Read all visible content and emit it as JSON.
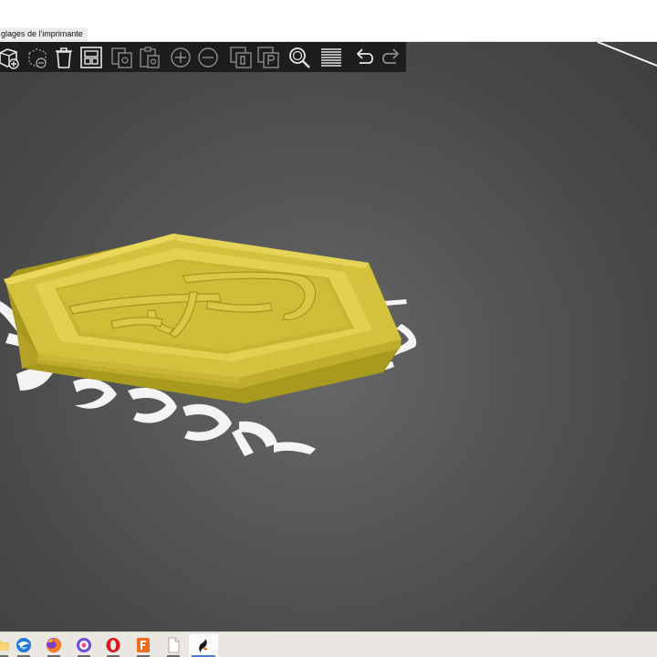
{
  "window": {
    "menu_tab_label": "glages de l'imprimante"
  },
  "toolbar": {
    "buttons": [
      {
        "name": "add-model-button",
        "icon": "add-model-icon"
      },
      {
        "name": "remove-model-button",
        "icon": "remove-model-icon"
      },
      {
        "name": "delete-button",
        "icon": "trash-icon"
      },
      {
        "name": "arrange-button",
        "icon": "arrange-icon"
      },
      {
        "name": "copy-button",
        "icon": "copy-icon"
      },
      {
        "name": "paste-button",
        "icon": "paste-icon"
      },
      {
        "name": "add-instance-button",
        "icon": "plus-circle-icon"
      },
      {
        "name": "remove-instance-button",
        "icon": "minus-circle-icon"
      },
      {
        "name": "split-objects-button",
        "icon": "split-objects-icon"
      },
      {
        "name": "split-parts-button",
        "icon": "split-parts-icon"
      },
      {
        "name": "search-button",
        "icon": "search-icon"
      },
      {
        "name": "layers-button",
        "icon": "layers-icon"
      },
      {
        "name": "undo-button",
        "icon": "undo-icon"
      },
      {
        "name": "redo-button",
        "icon": "redo-icon"
      }
    ]
  },
  "scene": {
    "bed_label_text": "Prusa Research Original i3 MK3S / Model Taquet (partial, skewed)",
    "model_color": "#d8c640",
    "background_color": "#4a4a4a"
  },
  "taskbar": {
    "apps": [
      {
        "name": "explorer-app",
        "icon": "folder-icon"
      },
      {
        "name": "thunderbird-app",
        "icon": "thunderbird-icon"
      },
      {
        "name": "firefox-app",
        "icon": "firefox-icon"
      },
      {
        "name": "teams-app",
        "icon": "teams-icon"
      },
      {
        "name": "opera-app",
        "icon": "opera-icon"
      },
      {
        "name": "flashprint-app",
        "icon": "flashprint-icon"
      },
      {
        "name": "notepad-app",
        "icon": "blank-document-icon"
      },
      {
        "name": "prusaslicer-app",
        "icon": "prusaslicer-icon"
      }
    ]
  }
}
